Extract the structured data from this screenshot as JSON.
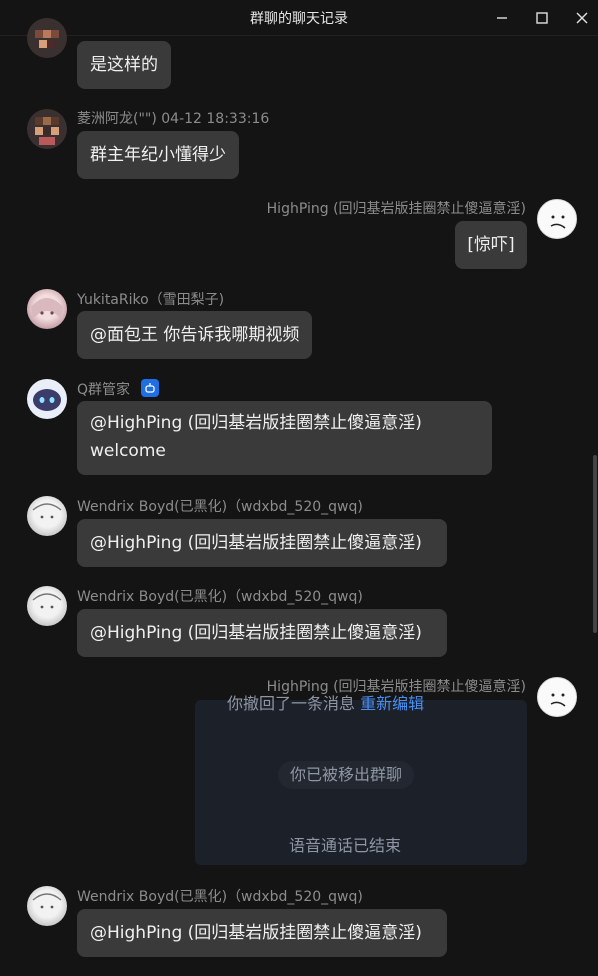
{
  "window": {
    "title": "群聊的聊天记录",
    "controls": [
      "minimize-icon",
      "maximize-icon",
      "close-icon"
    ]
  },
  "messages": [
    {
      "sender": "",
      "text": "是这样的"
    },
    {
      "sender": "菱洲阿龙(\"\") 04-12 18:33:16",
      "text": "群主年纪小懂得少"
    },
    {
      "sender": "HighPing (回归基岩版挂圈禁止傻逼意淫)",
      "text": "[惊吓]",
      "self": true
    },
    {
      "sender": "YukitaRiko（雪田梨子)",
      "text": "@面包王 你告诉我哪期视频"
    },
    {
      "sender": "Q群管家",
      "text_line1": "@HighPing (回归基岩版挂圈禁止傻逼意淫)",
      "text_line2": "welcome",
      "badge": "robot-badge-icon"
    },
    {
      "sender": "Wendrix Boyd(已黑化)（wdxbd_520_qwq)",
      "text": "@HighPing (回归基岩版挂圈禁止傻逼意淫)"
    },
    {
      "sender": "Wendrix Boyd(已黑化)（wdxbd_520_qwq)",
      "text": "@HighPing (回归基岩版挂圈禁止傻逼意淫)"
    },
    {
      "sender": "HighPing (回归基岩版挂圈禁止傻逼意淫)",
      "self": true
    },
    {
      "sender": "Wendrix Boyd(已黑化)（wdxbd_520_qwq)",
      "text": "@HighPing (回归基岩版挂圈禁止傻逼意淫)"
    }
  ],
  "system": {
    "recall": "你撤回了一条消息",
    "reedit": "重新编辑",
    "removed": "你已被移出群聊",
    "call_ended": "语音通话已结束"
  },
  "colors": {
    "background": "#141414",
    "bubble": "#3a3a3a",
    "link": "#4a8ef0",
    "badge": "#1e6fe6"
  }
}
